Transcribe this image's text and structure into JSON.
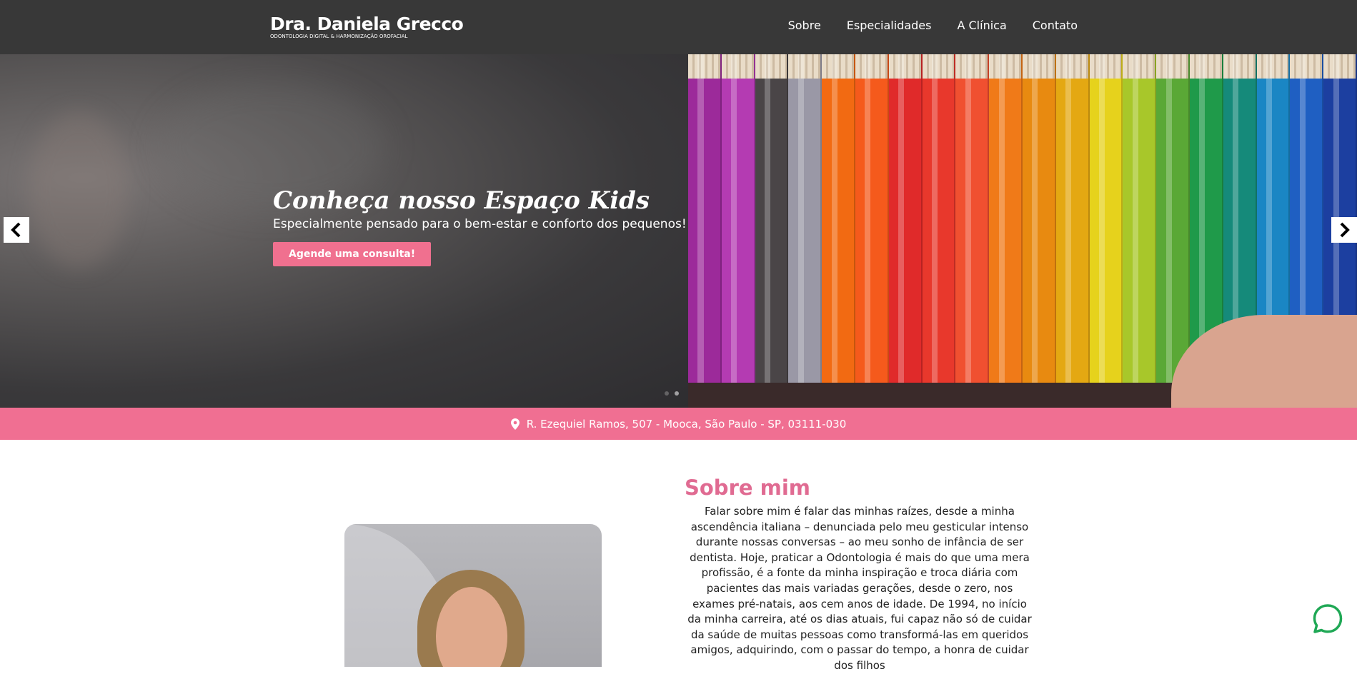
{
  "header": {
    "brand_name": "Dra. Daniela Grecco",
    "brand_tagline": "ODONTOLOGIA DIGITAL & HARMONIZAÇÃO OROFACIAL",
    "nav": [
      {
        "label": "Sobre"
      },
      {
        "label": "Especialidades"
      },
      {
        "label": "A Clínica"
      },
      {
        "label": "Contato"
      }
    ]
  },
  "hero": {
    "title": "Conheça nosso Espaço Kids",
    "subtitle": "Especialmente pensado para o bem-estar e conforto dos pequenos!",
    "cta_label": "Agende uma consulta!",
    "prev_icon": "chevron-left-icon",
    "next_icon": "chevron-right-icon",
    "slide_count": 2,
    "active_slide": 2,
    "pencil_colors": [
      "#9c2a9a",
      "#b43bb2",
      "#4a4547",
      "#9a98a6",
      "#f26a12",
      "#f55a1c",
      "#e02a2a",
      "#e8382c",
      "#f05030",
      "#f07a18",
      "#e88a10",
      "#e4a812",
      "#e6d21c",
      "#a8c72a",
      "#5aa836",
      "#1f9a4a",
      "#158a7a",
      "#1a86c4",
      "#1f5fc2",
      "#1c3fa0"
    ]
  },
  "address": {
    "icon": "location-pin-icon",
    "text": "R. Ezequiel Ramos, 507 - Mooca, São Paulo - SP, 03111-030"
  },
  "about": {
    "title": "Sobre mim",
    "text": "Falar sobre mim é falar das minhas raízes, desde a minha ascendência italiana – denunciada pelo meu gesticular intenso durante nossas conversas – ao meu sonho de infância de ser dentista. Hoje, praticar a Odontologia é mais do que uma mera profissão, é a fonte da minha inspiração e troca diária com pacientes das mais variadas gerações, desde o zero, nos exames pré-natais, aos cem anos de idade. De 1994, no início da minha carreira, até os dias atuais, fui capaz não só de cuidar da saúde de muitas pessoas como transformá-las em queridos amigos, adquirindo, com o passar do tempo, a honra de cuidar dos filhos"
  },
  "chat": {
    "icon": "whatsapp-icon"
  },
  "colors": {
    "header_bg": "#383838",
    "accent_pink": "#f06f92",
    "heading_pink": "#e06b92"
  }
}
